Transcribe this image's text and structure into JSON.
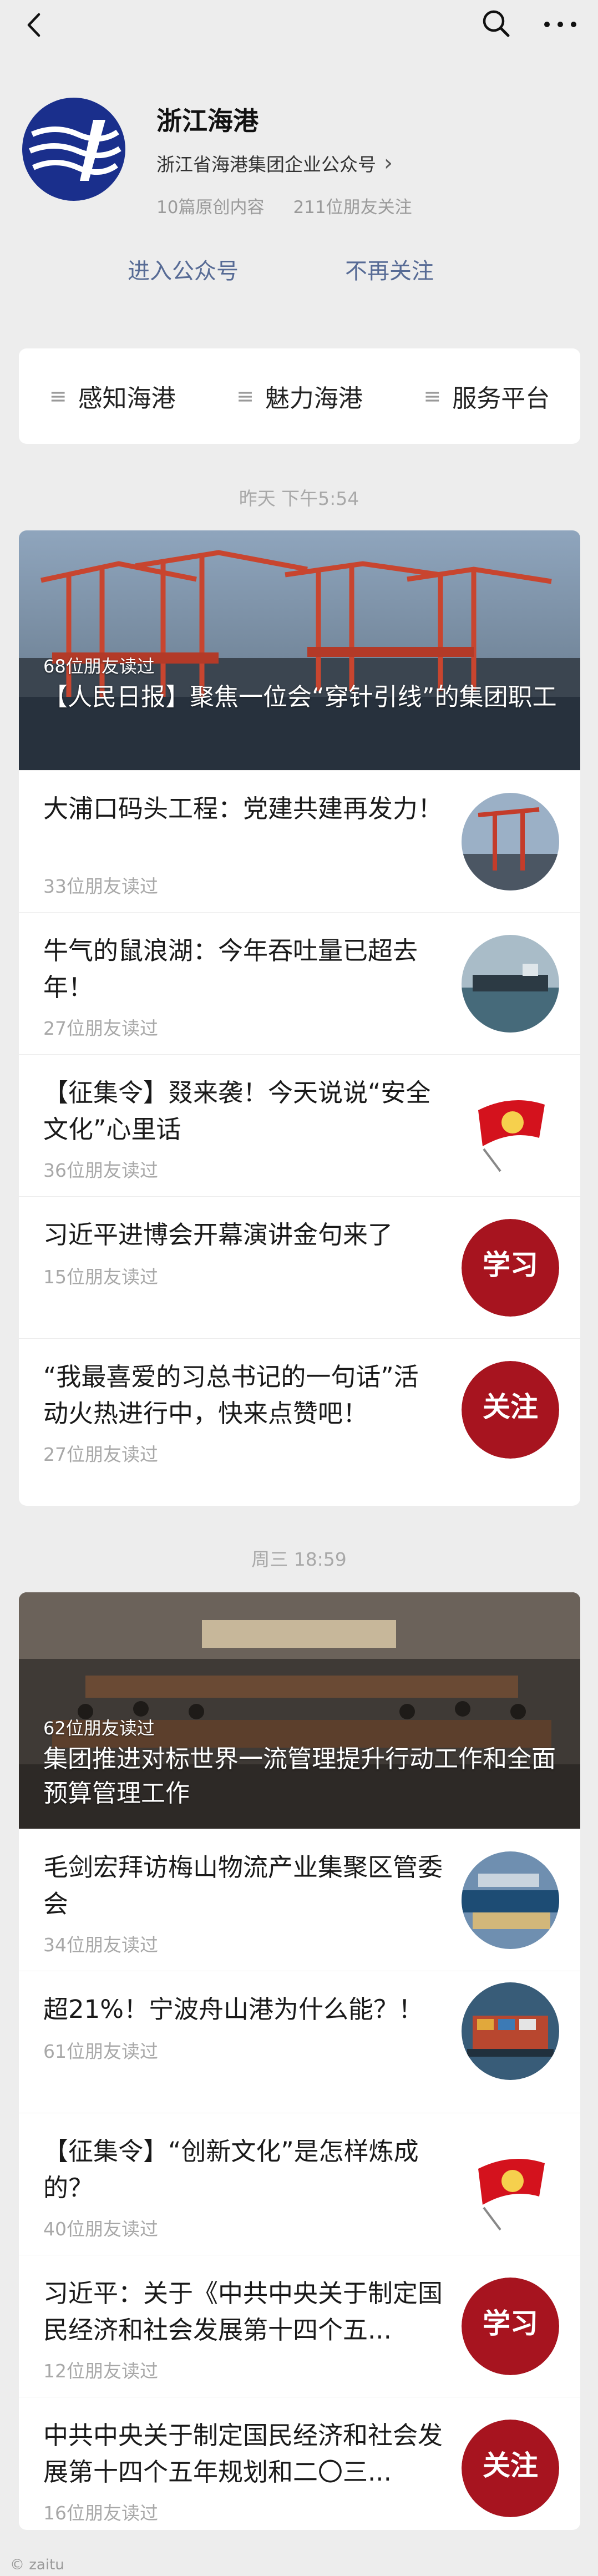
{
  "account": {
    "name": "浙江海港",
    "description": "浙江省海港集团企业公众号",
    "original_count": "10篇原创内容",
    "friends_following": "211位朋友关注",
    "enter_button": "进入公众号",
    "unfollow_button": "不再关注"
  },
  "menu": {
    "items": [
      {
        "label": "感知海港"
      },
      {
        "label": "魅力海港"
      },
      {
        "label": "服务平台"
      }
    ]
  },
  "groups": [
    {
      "date": "昨天 下午5:54",
      "hero": {
        "reads": "68位朋友读过",
        "title": "【人民日报】聚焦一位会“穿针引线”的集团职工"
      },
      "items": [
        {
          "title": "大浦口码头工程：党建共建再发力！",
          "reads": "33位朋友读过",
          "thumb": "crane-thumbnail"
        },
        {
          "title": "牛气的鼠浪湖：今年吞吐量已超去年！",
          "reads": "27位朋友读过",
          "thumb": "ship-thumbnail"
        },
        {
          "title": "【征集令】叕来袭！今天说说“安全文化”心里话",
          "reads": "36位朋友读过",
          "thumb": "flag-thumbnail"
        },
        {
          "title": "习近平进博会开幕演讲金句来了",
          "reads": "15位朋友读过",
          "thumb": "xuexi-thumbnail",
          "badge": "学习"
        },
        {
          "title": "“我最喜爱的习总书记的一句话”活动火热进行中，快来点赞吧！",
          "reads": "27位朋友读过",
          "thumb": "guanzhu-thumbnail",
          "badge": "关注"
        }
      ]
    },
    {
      "date": "周三 18:59",
      "hero": {
        "reads": "62位朋友读过",
        "title": "集团推进对标世界一流管理提升行动工作和全面预算管理工作"
      },
      "items": [
        {
          "title": "毛剑宏拜访梅山物流产业集聚区管委会",
          "reads": "34位朋友读过",
          "thumb": "port-aerial-thumbnail"
        },
        {
          "title": "超21%！宁波舟山港为什么能？！",
          "reads": "61位朋友读过",
          "thumb": "container-ship-thumbnail"
        },
        {
          "title": "【征集令】“创新文化”是怎样炼成的？",
          "reads": "40位朋友读过",
          "thumb": "flag-thumbnail"
        },
        {
          "title": "习近平：关于《中共中央关于制定国民经济和社会发展第十四个五...",
          "reads": "12位朋友读过",
          "thumb": "xuexi-thumbnail",
          "badge": "学习"
        },
        {
          "title": "中共中央关于制定国民经济和社会发展第十四个五年规划和二〇三...",
          "reads": "16位朋友读过",
          "thumb": "guanzhu-thumbnail",
          "badge": "关注"
        }
      ]
    }
  ],
  "watermark": "© zaitu",
  "colors": {
    "link": "#576b95",
    "background": "#ededed",
    "badge_red": "#b0121e",
    "logo_blue": "#1a2f8c"
  }
}
